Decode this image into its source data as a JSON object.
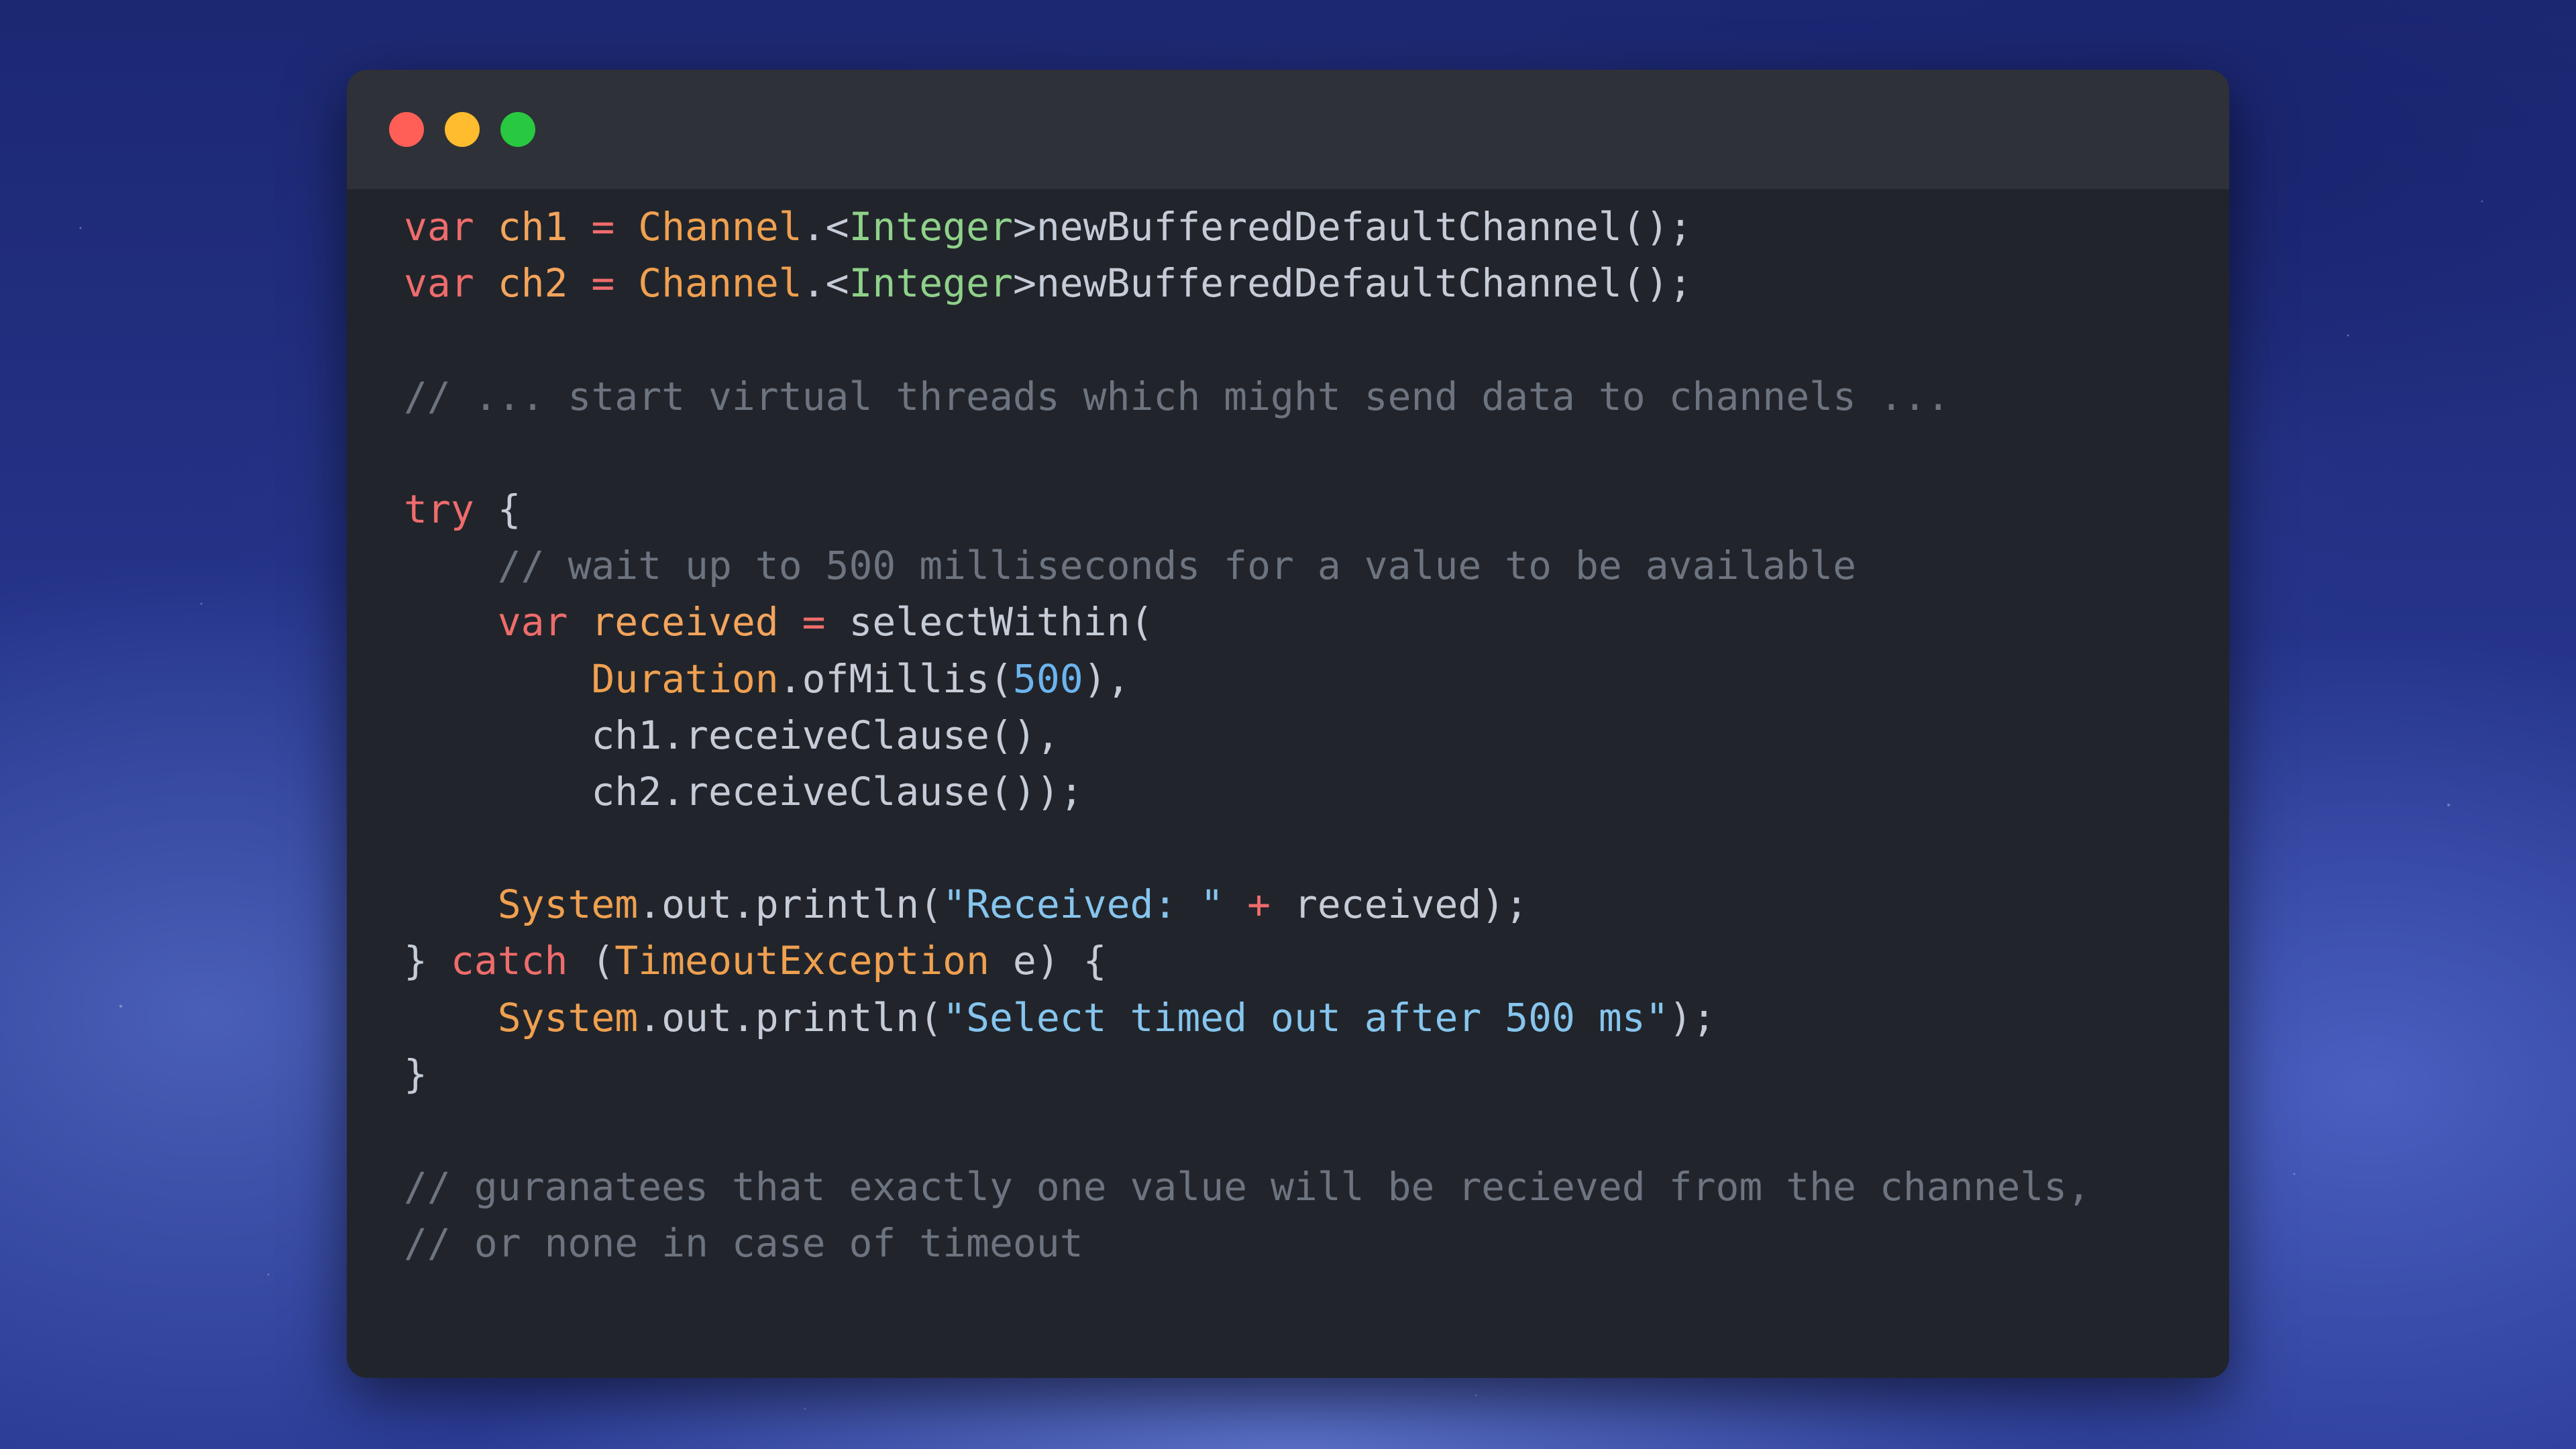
{
  "window": {
    "controls": {
      "close_icon": "close-dot-icon",
      "minimize_icon": "minimize-dot-icon",
      "maximize_icon": "maximize-dot-icon",
      "close_color": "#ff5f57",
      "minimize_color": "#febc2e",
      "maximize_color": "#28c840"
    }
  },
  "colors": {
    "keyword": "#ef6c6c",
    "variable": "#f4a45c",
    "class": "#f0a050",
    "generic_type": "#8fd18a",
    "comment": "#6d7480",
    "string": "#86c5ee",
    "number": "#6cb4ee",
    "text": "#c6ccd7",
    "editor_background": "#21252b",
    "titlebar_background": "#2e3138"
  },
  "code": {
    "language": "java",
    "lines": [
      [
        [
          "kw",
          "var"
        ],
        [
          "plain",
          " "
        ],
        [
          "var",
          "ch1"
        ],
        [
          "plain",
          " "
        ],
        [
          "kw",
          "="
        ],
        [
          "plain",
          " "
        ],
        [
          "cls",
          "Channel"
        ],
        [
          "plain",
          ".<"
        ],
        [
          "gen",
          "Integer"
        ],
        [
          "plain",
          ">newBufferedDefaultChannel();"
        ]
      ],
      [
        [
          "kw",
          "var"
        ],
        [
          "plain",
          " "
        ],
        [
          "var",
          "ch2"
        ],
        [
          "plain",
          " "
        ],
        [
          "kw",
          "="
        ],
        [
          "plain",
          " "
        ],
        [
          "cls",
          "Channel"
        ],
        [
          "plain",
          ".<"
        ],
        [
          "gen",
          "Integer"
        ],
        [
          "plain",
          ">newBufferedDefaultChannel();"
        ]
      ],
      [],
      [
        [
          "cmt",
          "// ... start virtual threads which might send data to channels ..."
        ]
      ],
      [],
      [
        [
          "kw",
          "try"
        ],
        [
          "plain",
          " {"
        ]
      ],
      [
        [
          "plain",
          "    "
        ],
        [
          "cmt",
          "// wait up to 500 milliseconds for a value to be available"
        ]
      ],
      [
        [
          "plain",
          "    "
        ],
        [
          "kw",
          "var"
        ],
        [
          "plain",
          " "
        ],
        [
          "var",
          "received"
        ],
        [
          "plain",
          " "
        ],
        [
          "kw",
          "="
        ],
        [
          "plain",
          " selectWithin("
        ]
      ],
      [
        [
          "plain",
          "        "
        ],
        [
          "cls",
          "Duration"
        ],
        [
          "plain",
          ".ofMillis("
        ],
        [
          "num",
          "500"
        ],
        [
          "plain",
          "),"
        ]
      ],
      [
        [
          "plain",
          "        ch1.receiveClause(),"
        ]
      ],
      [
        [
          "plain",
          "        ch2.receiveClause());"
        ]
      ],
      [],
      [
        [
          "plain",
          "    "
        ],
        [
          "cls",
          "System"
        ],
        [
          "plain",
          ".out.println("
        ],
        [
          "str",
          "\"Received: \""
        ],
        [
          "plain",
          " "
        ],
        [
          "kw",
          "+"
        ],
        [
          "plain",
          " received);"
        ]
      ],
      [
        [
          "plain",
          "} "
        ],
        [
          "kw",
          "catch"
        ],
        [
          "plain",
          " ("
        ],
        [
          "cls",
          "TimeoutException"
        ],
        [
          "plain",
          " e) {"
        ]
      ],
      [
        [
          "plain",
          "    "
        ],
        [
          "cls",
          "System"
        ],
        [
          "plain",
          ".out.println("
        ],
        [
          "str",
          "\"Select timed out after 500 ms\""
        ],
        [
          "plain",
          ");"
        ]
      ],
      [
        [
          "plain",
          "}"
        ]
      ],
      [],
      [
        [
          "cmt",
          "// guranatees that exactly one value will be recieved from the channels,"
        ]
      ],
      [
        [
          "cmt",
          "// or none in case of timeout"
        ]
      ]
    ]
  }
}
